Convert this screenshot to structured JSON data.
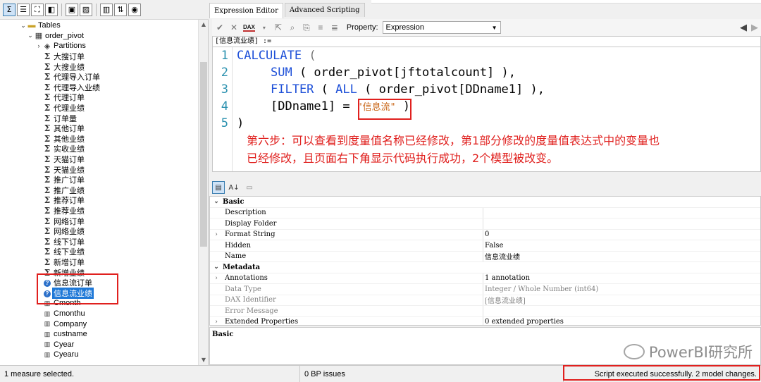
{
  "toolbar": {
    "buttons": [
      {
        "icon": "sigma-icon",
        "glyph": "Σ"
      },
      {
        "icon": "list-icon",
        "glyph": "☰"
      },
      {
        "icon": "hierarchy-icon",
        "glyph": "⛶"
      },
      {
        "icon": "cube-icon",
        "glyph": "◧"
      },
      {
        "icon": "table-hide-icon",
        "glyph": "▣"
      },
      {
        "icon": "filter-off-icon",
        "glyph": "▨"
      },
      {
        "icon": "columns-icon",
        "glyph": "▥"
      },
      {
        "icon": "sort-icon",
        "glyph": "⇅"
      },
      {
        "icon": "sync-icon",
        "glyph": "◉"
      }
    ]
  },
  "tree": {
    "tables_label": "Tables",
    "table_name": "order_pivot",
    "partitions_label": "Partitions",
    "measures": [
      "大搜订单",
      "大搜业绩",
      "代理导入订单",
      "代理导入业绩",
      "代理订单",
      "代理业绩",
      "订单量",
      "其他订单",
      "其他业绩",
      "实收业绩",
      "天猫订单",
      "天猫业绩",
      "推广订单",
      "推广业绩",
      "推荐订单",
      "推荐业绩",
      "网络订单",
      "网络业绩",
      "线下订单",
      "线下业绩",
      "新增订单",
      "新增业绩"
    ],
    "modified": [
      "信息流订单",
      "信息流业绩"
    ],
    "columns": [
      "Cmonth",
      "Cmonthu",
      "Company",
      "custname",
      "Cyear",
      "Cyearu"
    ]
  },
  "tabs": [
    "Expression Editor",
    "Advanced Scripting"
  ],
  "expr_toolbar": {
    "property_label": "Property:",
    "property_value": "Expression",
    "dax_label": "DAX"
  },
  "measure_header": "[信息流业绩] :=",
  "code": {
    "line_numbers": [
      "1",
      "2",
      "3",
      "4",
      "5"
    ],
    "l1_kw": "CALCULATE",
    "l1_p": " (",
    "l2_kw": "SUM",
    "l2_rest": " ( order_pivot[jftotalcount] ),",
    "l3_kw": "FILTER",
    "l3_mid": " ( ",
    "l3_kw2": "ALL",
    "l3_rest": " ( order_pivot[DDname1] ),",
    "l4_a": "[DDname1] = ",
    "l4_str": "\"信息流\"",
    "l4_b": " )",
    "l5": ")"
  },
  "annotation": {
    "line1": "第六步：可以查看到度量值名称已经修改，第1部分修改的度量值表达式中的变量也",
    "line2": "已经修改，且页面右下角显示代码执行成功，2个模型被改变。"
  },
  "properties": {
    "cat_basic": "Basic",
    "cat_metadata": "Metadata",
    "rows": [
      {
        "name": "Description",
        "value": ""
      },
      {
        "name": "Display Folder",
        "value": ""
      },
      {
        "name": "Format String",
        "value": "0"
      },
      {
        "name": "Hidden",
        "value": "False"
      },
      {
        "name": "Name",
        "value": "信息流业绩"
      },
      {
        "name": "Annotations",
        "value": "1 annotation"
      },
      {
        "name": "Data Type",
        "value": "Integer / Whole Number (int64)"
      },
      {
        "name": "DAX Identifier",
        "value": "[信息流业绩]"
      },
      {
        "name": "Error Message",
        "value": ""
      },
      {
        "name": "Extended Properties",
        "value": "0 extended properties"
      }
    ],
    "description_title": "Basic"
  },
  "watermark": "PowerBI研究所",
  "status": {
    "selection": "1 measure selected.",
    "bp": "0 BP issues",
    "result": "Script executed successfully. 2 model changes."
  },
  "colors": {
    "keyword": "#1e50d8",
    "string": "#c86414",
    "annotation": "#e0201e",
    "selection": "#1e78d7"
  }
}
